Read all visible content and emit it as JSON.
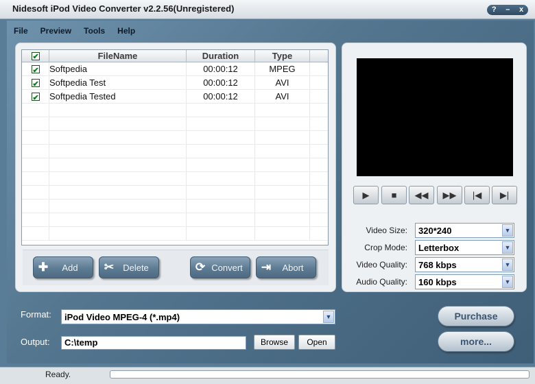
{
  "window": {
    "title": "Nidesoft iPod Video Converter v2.2.56(Unregistered)",
    "help_glyph": "?",
    "minimize_glyph": "–",
    "close_glyph": "x"
  },
  "menu": [
    "File",
    "Preview",
    "Tools",
    "Help"
  ],
  "table": {
    "headers": [
      "FileName",
      "Duration",
      "Type"
    ],
    "rows": [
      {
        "checked": true,
        "name": "Softpedia",
        "duration": "00:00:12",
        "type": "MPEG"
      },
      {
        "checked": true,
        "name": "Softpedia Test",
        "duration": "00:00:12",
        "type": "AVI"
      },
      {
        "checked": true,
        "name": "Softpedia Tested",
        "duration": "00:00:12",
        "type": "AVI"
      }
    ]
  },
  "actions": {
    "add": "Add",
    "delete": "Delete",
    "convert": "Convert",
    "abort": "Abort"
  },
  "player": {
    "controls": [
      "play-icon",
      "stop-icon",
      "rewind-icon",
      "fast-forward-icon",
      "skip-start-icon",
      "skip-end-icon"
    ]
  },
  "settings": {
    "video_size_label": "Video Size:",
    "video_size": "320*240",
    "crop_mode_label": "Crop Mode:",
    "crop_mode": "Letterbox",
    "video_quality_label": "Video Quality:",
    "video_quality": "768 kbps",
    "audio_quality_label": "Audio Quality:",
    "audio_quality": "160 kbps"
  },
  "output": {
    "format_label": "Format:",
    "format_value": "iPod Video MPEG-4 (*.mp4)",
    "output_label": "Output:",
    "output_value": "C:\\temp",
    "browse": "Browse",
    "open": "Open"
  },
  "side_buttons": {
    "purchase": "Purchase",
    "more": "more..."
  },
  "status": {
    "text": "Ready.",
    "progress": 0
  },
  "colors": {
    "background": "#5a7d97",
    "panel": "#eef1f4",
    "accent": "#3a5670",
    "checkbox_check": "#0a7a1e"
  }
}
